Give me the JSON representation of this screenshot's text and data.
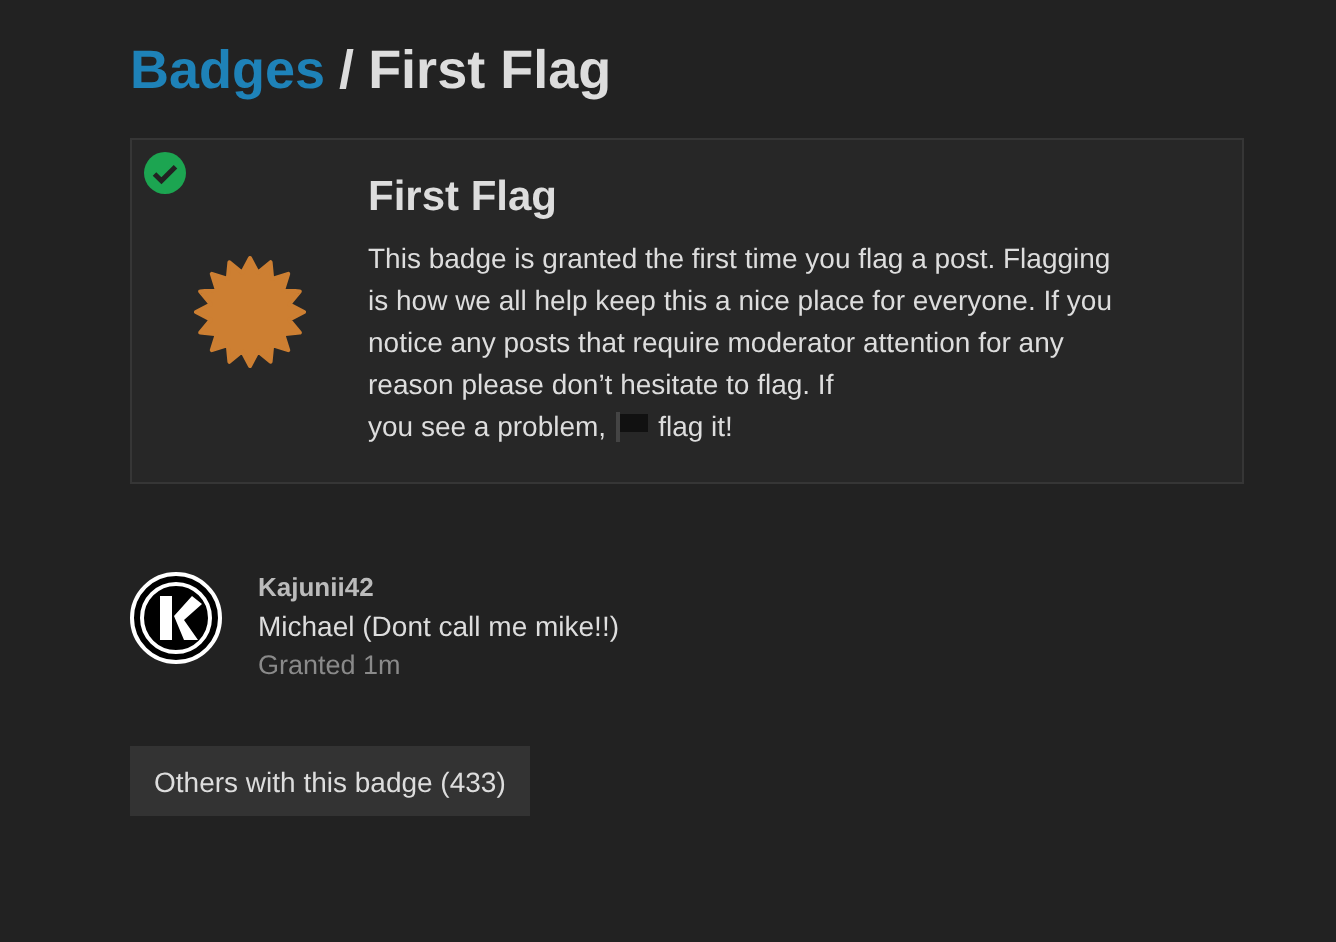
{
  "breadcrumb": {
    "parent": "Badges",
    "separator": "/",
    "current": "First Flag"
  },
  "badge": {
    "granted": true,
    "title": "First Flag",
    "description_before": "This badge is granted the first time you flag a post. Flagging is how we all help keep this a nice place for everyone. If you notice any posts that require moderator attention for any reason please don’t hesitate to flag. If",
    "description_mid": "you see a problem,",
    "description_after": "flag it!"
  },
  "grants": [
    {
      "username": "Kajunii42",
      "name": "Michael (Dont call me mike!!)",
      "granted": "Granted 1m"
    }
  ],
  "others_button": "Others with this badge (433)"
}
